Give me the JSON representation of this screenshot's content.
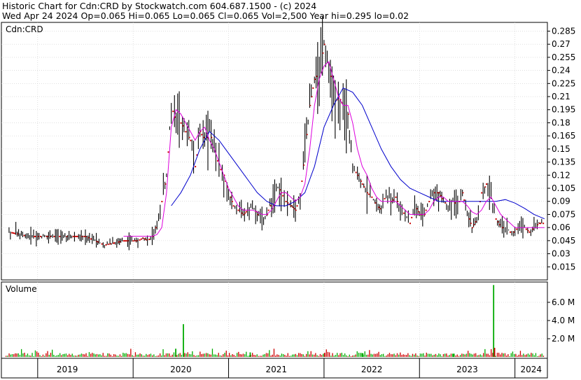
{
  "header": {
    "line1": "Historic Chart for Cdn:CRD by Stockwatch.com 604.687.1500 - (c) 2024",
    "line2": "Wed Apr 24 2024   Op=0.065   Hi=0.065   Lo=0.065   Cl=0.065   Vol=2,500   Year hi=0.295   lo=0.02"
  },
  "colors": {
    "ma_short": "#dd00dd",
    "ma_long": "#0000cc",
    "price_bar": "#000000",
    "price_dot": "#cc0000",
    "vol_up": "#00aa00",
    "vol_down": "#cc0000",
    "grid": "#cccccc"
  },
  "chart_data": [
    {
      "type": "line",
      "title": "Cdn:CRD",
      "ylim": [
        0,
        0.295
      ],
      "y_ticks": [
        0.285,
        0.27,
        0.255,
        0.24,
        0.225,
        0.21,
        0.195,
        0.18,
        0.165,
        0.15,
        0.135,
        0.12,
        0.105,
        0.09,
        0.075,
        0.06,
        0.045,
        0.03,
        0.015
      ],
      "x_ticks": [
        "2019",
        "2020",
        "2021",
        "2022",
        "2023",
        "2024"
      ],
      "grid": true,
      "series": [
        {
          "kind": "price",
          "x": [
            2018.7,
            2018.9,
            2019.1,
            2019.3,
            2019.5,
            2019.7,
            2019.9,
            2020.0,
            2020.05,
            2020.1,
            2020.15,
            2020.2,
            2020.25,
            2020.3,
            2020.35,
            2020.4,
            2020.45,
            2020.5,
            2020.55,
            2020.6,
            2020.65,
            2020.7,
            2020.75,
            2020.8,
            2020.85,
            2020.9,
            2020.95,
            2021.0,
            2021.05,
            2021.1,
            2021.15,
            2021.2,
            2021.25,
            2021.3,
            2021.35,
            2021.4,
            2021.45,
            2021.5,
            2021.55,
            2021.6,
            2021.65,
            2021.7,
            2021.75,
            2021.8,
            2021.85,
            2021.9,
            2021.95,
            2022.0,
            2022.05,
            2022.1,
            2022.15,
            2022.2,
            2022.25,
            2022.3,
            2022.35,
            2022.4,
            2022.45,
            2022.5,
            2022.55,
            2022.6,
            2022.65,
            2022.7,
            2022.75,
            2022.8,
            2022.85,
            2022.9,
            2022.95,
            2023.0,
            2023.05,
            2023.1,
            2023.15,
            2023.2,
            2023.25,
            2023.3,
            2023.35,
            2023.4,
            2023.45,
            2023.5,
            2023.55,
            2023.6,
            2023.65,
            2023.7,
            2023.75,
            2023.8,
            2023.85,
            2023.9,
            2023.95,
            2024.0,
            2024.05,
            2024.1,
            2024.15,
            2024.2,
            2024.25,
            2024.31
          ],
          "y": [
            0.055,
            0.05,
            0.05,
            0.05,
            0.05,
            0.04,
            0.045,
            0.045,
            0.045,
            0.048,
            0.045,
            0.05,
            0.065,
            0.09,
            0.12,
            0.2,
            0.18,
            0.18,
            0.17,
            0.16,
            0.13,
            0.17,
            0.16,
            0.17,
            0.15,
            0.13,
            0.12,
            0.1,
            0.085,
            0.08,
            0.075,
            0.08,
            0.085,
            0.075,
            0.07,
            0.075,
            0.09,
            0.11,
            0.1,
            0.09,
            0.085,
            0.08,
            0.095,
            0.15,
            0.2,
            0.23,
            0.24,
            0.27,
            0.25,
            0.2,
            0.21,
            0.2,
            0.19,
            0.13,
            0.12,
            0.11,
            0.1,
            0.095,
            0.085,
            0.08,
            0.1,
            0.09,
            0.095,
            0.08,
            0.075,
            0.065,
            0.085,
            0.075,
            0.075,
            0.09,
            0.1,
            0.1,
            0.09,
            0.085,
            0.09,
            0.085,
            0.1,
            0.075,
            0.06,
            0.07,
            0.1,
            0.11,
            0.095,
            0.07,
            0.06,
            0.06,
            0.055,
            0.055,
            0.065,
            0.06,
            0.055,
            0.06,
            0.065,
            0.065
          ]
        },
        {
          "name": "",
          "kind": "ma_short",
          "x": [
            2019.9,
            2020.0,
            2020.1,
            2020.2,
            2020.25,
            2020.3,
            2020.35,
            2020.4,
            2020.45,
            2020.5,
            2020.55,
            2020.6,
            2020.65,
            2020.7,
            2020.75,
            2020.8,
            2020.85,
            2020.9,
            2020.95,
            2021.0,
            2021.05,
            2021.1,
            2021.15,
            2021.2,
            2021.25,
            2021.3,
            2021.35,
            2021.4,
            2021.45,
            2021.5,
            2021.55,
            2021.6,
            2021.65,
            2021.7,
            2021.75,
            2021.8,
            2021.85,
            2021.9,
            2021.95,
            2022.0,
            2022.05,
            2022.1,
            2022.15,
            2022.2,
            2022.25,
            2022.3,
            2022.35,
            2022.4,
            2022.45,
            2022.5,
            2022.55,
            2022.6,
            2022.65,
            2022.7,
            2022.75,
            2022.8,
            2022.85,
            2022.9,
            2022.95,
            2023.0,
            2023.05,
            2023.1,
            2023.15,
            2023.2,
            2023.25,
            2023.3,
            2023.35,
            2023.4,
            2023.45,
            2023.5,
            2023.55,
            2023.6,
            2023.65,
            2023.7,
            2023.75,
            2023.8,
            2023.85,
            2023.9,
            2023.95,
            2024.0,
            2024.05,
            2024.1,
            2024.15,
            2024.2,
            2024.31
          ],
          "y": [
            0.05,
            0.05,
            0.05,
            0.05,
            0.052,
            0.06,
            0.1,
            0.175,
            0.195,
            0.19,
            0.18,
            0.17,
            0.16,
            0.17,
            0.175,
            0.16,
            0.15,
            0.135,
            0.12,
            0.105,
            0.095,
            0.085,
            0.08,
            0.08,
            0.08,
            0.078,
            0.075,
            0.075,
            0.08,
            0.09,
            0.1,
            0.1,
            0.095,
            0.09,
            0.095,
            0.11,
            0.15,
            0.2,
            0.23,
            0.245,
            0.25,
            0.23,
            0.21,
            0.2,
            0.2,
            0.18,
            0.15,
            0.13,
            0.12,
            0.105,
            0.095,
            0.09,
            0.09,
            0.09,
            0.09,
            0.085,
            0.08,
            0.075,
            0.075,
            0.075,
            0.075,
            0.08,
            0.09,
            0.095,
            0.095,
            0.09,
            0.09,
            0.09,
            0.09,
            0.085,
            0.078,
            0.075,
            0.08,
            0.09,
            0.095,
            0.085,
            0.075,
            0.07,
            0.065,
            0.06,
            0.06,
            0.06,
            0.06,
            0.06,
            0.06
          ]
        },
        {
          "name": "",
          "kind": "ma_long",
          "x": [
            2020.4,
            2020.5,
            2020.6,
            2020.7,
            2020.8,
            2020.9,
            2021.0,
            2021.1,
            2021.2,
            2021.3,
            2021.4,
            2021.5,
            2021.6,
            2021.7,
            2021.8,
            2021.9,
            2022.0,
            2022.1,
            2022.2,
            2022.3,
            2022.4,
            2022.5,
            2022.6,
            2022.7,
            2022.8,
            2022.9,
            2023.0,
            2023.1,
            2023.2,
            2023.3,
            2023.4,
            2023.5,
            2023.6,
            2023.7,
            2023.8,
            2023.9,
            2024.0,
            2024.1,
            2024.2,
            2024.31
          ],
          "y": [
            0.085,
            0.1,
            0.12,
            0.15,
            0.17,
            0.16,
            0.145,
            0.13,
            0.115,
            0.1,
            0.09,
            0.085,
            0.085,
            0.09,
            0.1,
            0.13,
            0.175,
            0.2,
            0.22,
            0.215,
            0.2,
            0.175,
            0.15,
            0.13,
            0.115,
            0.105,
            0.1,
            0.095,
            0.09,
            0.09,
            0.09,
            0.09,
            0.09,
            0.09,
            0.09,
            0.092,
            0.088,
            0.082,
            0.075,
            0.07
          ]
        }
      ]
    },
    {
      "type": "bar",
      "title": "Volume",
      "ylim": [
        0,
        8000000
      ],
      "y_ticks": [
        "6.0 M",
        "4.0 M",
        "2.0 M"
      ],
      "spikes": [
        {
          "x": 2020.52,
          "value": 3600000,
          "color": "vol_up"
        },
        {
          "x": 2020.44,
          "value": 900000,
          "color": "vol_up"
        },
        {
          "x": 2023.77,
          "value": 7900000,
          "color": "vol_up"
        },
        {
          "x": 2023.78,
          "value": 1000000,
          "color": "vol_down"
        },
        {
          "x": 2021.22,
          "value": 500000,
          "color": "vol_up"
        },
        {
          "x": 2022.0,
          "value": 450000,
          "color": "vol_down"
        },
        {
          "x": 2022.4,
          "value": 400000,
          "color": "vol_up"
        },
        {
          "x": 2023.35,
          "value": 350000,
          "color": "vol_up"
        }
      ]
    }
  ]
}
